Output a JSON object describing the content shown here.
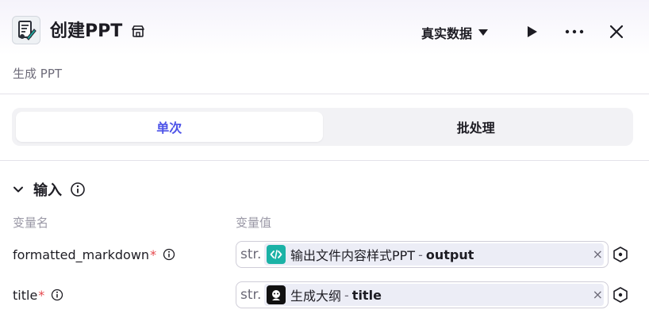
{
  "header": {
    "title": "创建PPT",
    "subtitle": "生成 PPT",
    "data_mode": "真实数据",
    "node_icon": "presentation-doc-icon",
    "store_icon": "store-icon"
  },
  "tabs": [
    {
      "label": "单次",
      "active": true
    },
    {
      "label": "批处理",
      "active": false
    }
  ],
  "inputs": {
    "section_title": "输入",
    "col_name": "变量名",
    "col_value": "变量值",
    "rows": [
      {
        "name": "formatted_markdown",
        "required": "*",
        "type": "str.",
        "ref_node": "输出文件内容样式PPT",
        "ref_sep": "-",
        "ref_field": "output",
        "ref_icon": "code-icon",
        "ref_icon_color": "#1bb2a6"
      },
      {
        "name": "title",
        "required": "*",
        "type": "str.",
        "ref_node": "生成大纲",
        "ref_sep": "-",
        "ref_field": "title",
        "ref_icon": "llm-avatar-icon",
        "ref_icon_color": "#111111"
      }
    ]
  },
  "colors": {
    "accent": "#4d53e8",
    "required": "#e5484d"
  }
}
